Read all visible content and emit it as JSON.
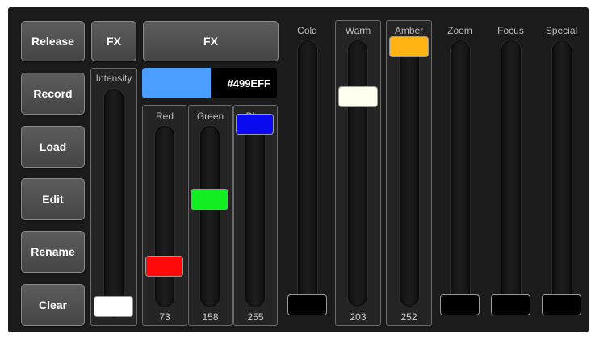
{
  "buttons": [
    "Release",
    "Record",
    "Load",
    "Edit",
    "Rename",
    "Clear"
  ],
  "fx": {
    "small_label": "FX",
    "wide_label": "FX"
  },
  "intensity": {
    "label": "Intensity",
    "level": 0.0,
    "handle_color": "#ffffff"
  },
  "color": {
    "hex": "#499EFF",
    "swatch": "#499EFF"
  },
  "rgb": [
    {
      "label": "Red",
      "value": "73",
      "level": 0.286,
      "handle_color": "#ff0a0a"
    },
    {
      "label": "Green",
      "value": "158",
      "level": 0.62,
      "handle_color": "#11ee22"
    },
    {
      "label": "Blue",
      "value": "255",
      "level": 1.0,
      "handle_color": "#0a0af0"
    }
  ],
  "faders": [
    {
      "label": "Cold",
      "value": "",
      "level": 0.0,
      "handle_color": "#000000",
      "boxed": false
    },
    {
      "label": "Warm",
      "value": "203",
      "level": 0.796,
      "handle_color": "#fffff0",
      "boxed": true
    },
    {
      "label": "Amber",
      "value": "252",
      "level": 0.988,
      "handle_color": "#ffb414",
      "boxed": true
    },
    {
      "label": "Zoom",
      "value": "",
      "level": 0.0,
      "handle_color": "#000000",
      "boxed": false
    },
    {
      "label": "Focus",
      "value": "",
      "level": 0.0,
      "handle_color": "#000000",
      "boxed": false
    },
    {
      "label": "Special",
      "value": "",
      "level": 0.0,
      "handle_color": "#000000",
      "boxed": false
    }
  ]
}
